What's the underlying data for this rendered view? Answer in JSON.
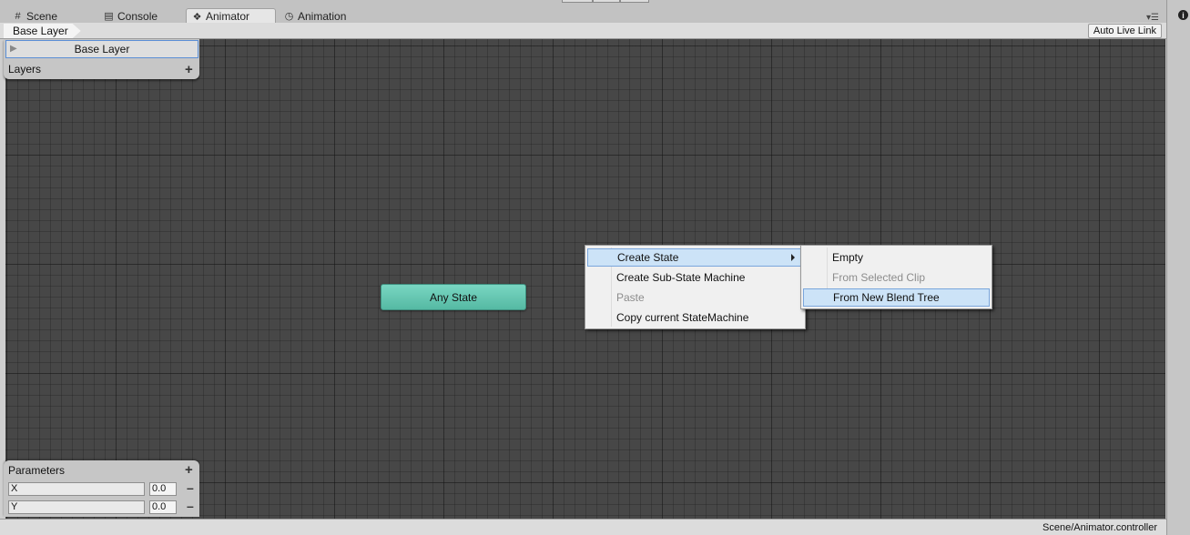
{
  "tabs": [
    {
      "label": "Scene",
      "icon": "grid-icon"
    },
    {
      "label": "Console",
      "icon": "console-icon"
    },
    {
      "label": "Animator",
      "icon": "animator-icon"
    },
    {
      "label": "Animation",
      "icon": "clock-icon"
    }
  ],
  "toolbar": {
    "breadcrumb": "Base Layer",
    "auto_live_link": "Auto Live Link"
  },
  "layers": {
    "header": "Layers",
    "items": [
      {
        "label": "Base Layer"
      }
    ]
  },
  "graph": {
    "any_state": "Any State"
  },
  "context_menu": {
    "items": [
      {
        "label": "Create State",
        "enabled": true,
        "has_submenu": true,
        "highlighted": true
      },
      {
        "label": "Create Sub-State Machine",
        "enabled": true
      },
      {
        "label": "Paste",
        "enabled": false
      },
      {
        "label": "Copy current StateMachine",
        "enabled": true
      }
    ]
  },
  "submenu": {
    "items": [
      {
        "label": "Empty",
        "enabled": true
      },
      {
        "label": "From Selected Clip",
        "enabled": false
      },
      {
        "label": "From New Blend Tree",
        "enabled": true,
        "highlighted": true
      }
    ]
  },
  "parameters": {
    "header": "Parameters",
    "items": [
      {
        "name": "X",
        "value": "0.0"
      },
      {
        "name": "Y",
        "value": "0.0"
      }
    ]
  },
  "status": {
    "path": "Scene/Animator.controller"
  },
  "colors": {
    "canvas": "#474747",
    "any_state_node": "#62c4ae",
    "menu_highlight": "#cce3f7"
  }
}
